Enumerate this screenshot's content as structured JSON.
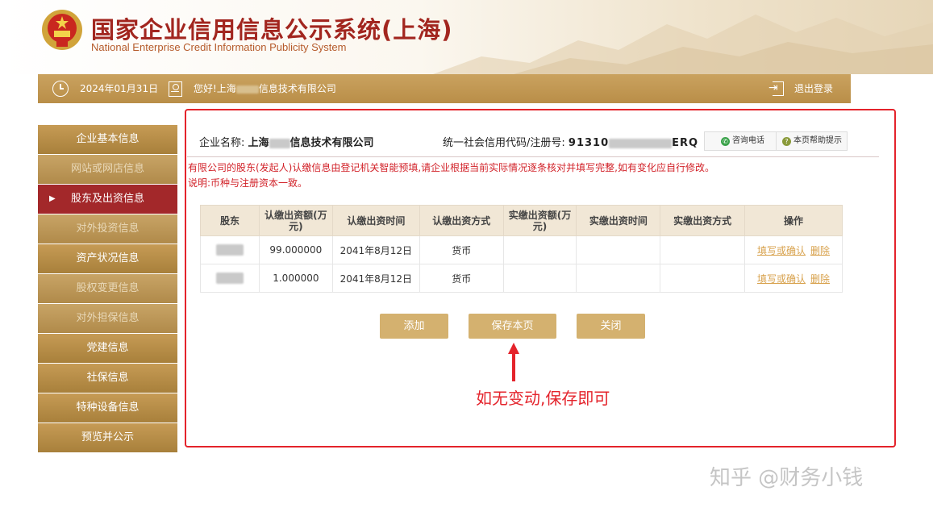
{
  "header": {
    "title": "国家企业信用信息公示系统(上海)",
    "subtitle": "National Enterprise Credit Information Publicity System"
  },
  "statusbar": {
    "date": "2024年01月31日",
    "greeting_prefix": "您好!上海",
    "greeting_suffix": "信息技术有限公司",
    "logout": "退出登录"
  },
  "sidebar": {
    "items": [
      {
        "label": "企业基本信息",
        "state": "normal"
      },
      {
        "label": "网站或网店信息",
        "state": "disabled"
      },
      {
        "label": "股东及出资信息",
        "state": "active"
      },
      {
        "label": "对外投资信息",
        "state": "disabled"
      },
      {
        "label": "资产状况信息",
        "state": "normal"
      },
      {
        "label": "股权变更信息",
        "state": "disabled"
      },
      {
        "label": "对外担保信息",
        "state": "disabled"
      },
      {
        "label": "党建信息",
        "state": "normal"
      },
      {
        "label": "社保信息",
        "state": "normal"
      },
      {
        "label": "特种设备信息",
        "state": "normal"
      },
      {
        "label": "预览并公示",
        "state": "normal"
      }
    ]
  },
  "company": {
    "name_label": "企业名称:",
    "name_prefix": "上海",
    "name_suffix": "信息技术有限公司",
    "credit_label": "统一社会信用代码/注册号:",
    "credit_prefix": "91310",
    "credit_suffix": "ERQ"
  },
  "sub_buttons": {
    "phone": "咨询电话",
    "help": "本页帮助提示"
  },
  "notices": [
    "有限公司的股东(发起人)认缴信息由登记机关智能预填,请企业根据当前实际情况逐条核对并填写完整,如有变化应自行修改。",
    "说明:币种与注册资本一致。"
  ],
  "table": {
    "headers": [
      "股东",
      "认缴出资额(万元)",
      "认缴出资时间",
      "认缴出资方式",
      "实缴出资额(万元)",
      "实缴出资时间",
      "实缴出资方式",
      "操作"
    ],
    "rows": [
      {
        "amount": "99.000000",
        "date": "2041年8月12日",
        "method": "货币"
      },
      {
        "amount": "1.000000",
        "date": "2041年8月12日",
        "method": "货币"
      }
    ],
    "action_fill": "填写或确认",
    "action_delete": "删除"
  },
  "buttons": {
    "add": "添加",
    "save": "保存本页",
    "close": "关闭"
  },
  "annotation": "如无变动,保存即可",
  "watermark": "知乎 @财务小钱",
  "colors": {
    "brand_red": "#a2261f",
    "gold": "#c69b55",
    "active_red": "#a3282a",
    "notice_red": "#d2232a",
    "annotation_red": "#e4232b"
  },
  "icons": [
    "national-emblem-icon",
    "clock-icon",
    "user-icon",
    "logout-icon",
    "phone-icon",
    "help-icon",
    "arrow-right-icon",
    "up-arrow-annotation"
  ]
}
